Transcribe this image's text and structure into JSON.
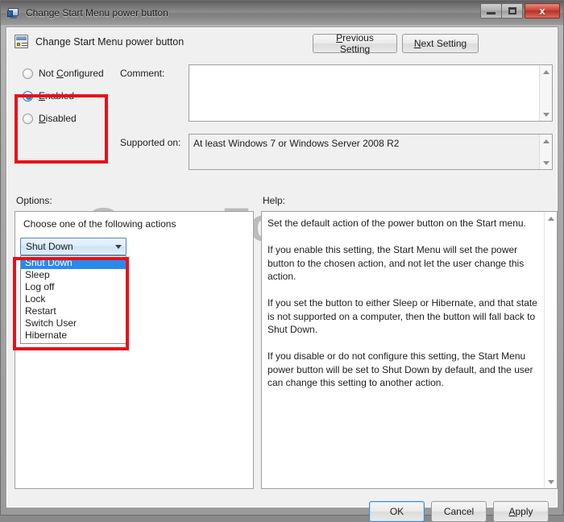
{
  "window": {
    "title": "Change Start Menu power button",
    "icon": "policy-setting-icon",
    "caption_buttons": {
      "minimize": "minimize-icon",
      "maximize": "maximize-icon",
      "close": "x"
    }
  },
  "header": {
    "icon": "group-policy-setting-icon",
    "title": "Change Start Menu power button",
    "previous_setting": "Previous Setting",
    "previous_setting_accel": "P",
    "next_setting": "Next Setting",
    "next_setting_accel": "N"
  },
  "state": {
    "options": [
      {
        "label": "Not Configured",
        "accel": "C",
        "checked": false
      },
      {
        "label": "Enabled",
        "accel": "E",
        "checked": true
      },
      {
        "label": "Disabled",
        "accel": "D",
        "checked": false
      }
    ]
  },
  "comment": {
    "label": "Comment:",
    "value": ""
  },
  "supported_on": {
    "label": "Supported on:",
    "value": "At least Windows 7 or Windows Server 2008 R2"
  },
  "options_section": {
    "label": "Options:",
    "prompt": "Choose one of the following actions",
    "combo": {
      "selected": "Shut Down",
      "items": [
        "Shut Down",
        "Sleep",
        "Log off",
        "Lock",
        "Restart",
        "Switch User",
        "Hibernate"
      ],
      "expanded": true,
      "highlighted_index": 0
    }
  },
  "help_section": {
    "label": "Help:",
    "text": "Set the default action of the power button on the Start menu.\n\nIf you enable this setting, the Start Menu will set the power button to the chosen action, and not let the user change this action.\n\nIf you set the button to either Sleep or Hibernate, and that state is not supported on a computer, then the button will fall back to Shut Down.\n\nIf you disable or do not configure this setting, the Start Menu power button will be set to Shut Down by default, and the user can change this setting to another action."
  },
  "footer": {
    "ok": "OK",
    "cancel": "Cancel",
    "apply": "Apply",
    "apply_accel": "A"
  },
  "watermark": {
    "text": "SevenForums.com"
  },
  "annotations": {
    "accent_color": "#e8101a",
    "boxes": [
      {
        "name": "state-radio-group"
      },
      {
        "name": "action-combobox"
      }
    ]
  }
}
